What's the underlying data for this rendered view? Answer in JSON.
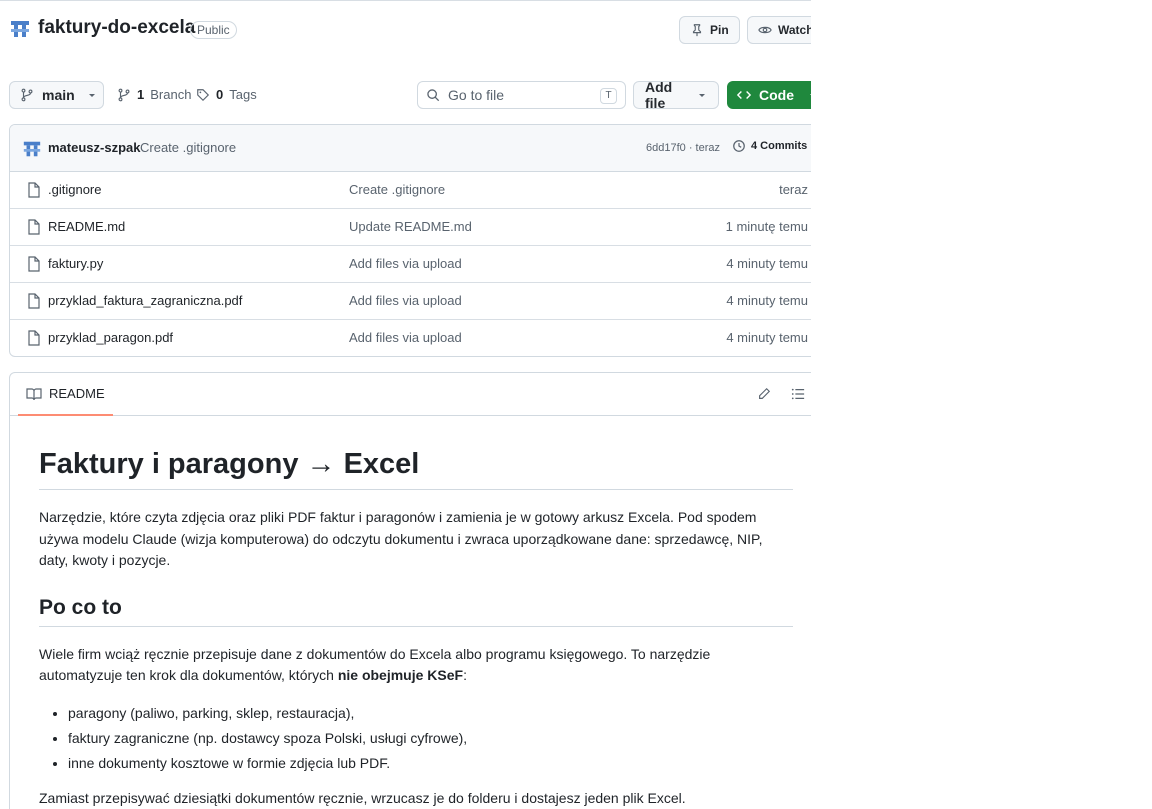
{
  "repo": {
    "name": "faktury-do-excela",
    "visibility": "Public",
    "pin_label": "Pin",
    "watch_label": "Watch"
  },
  "toolbar": {
    "branch": "main",
    "branch_count": "1",
    "branch_label": "Branch",
    "tag_count": "0",
    "tag_label": "Tags",
    "goto_placeholder": "Go to file",
    "goto_shortcut": "T",
    "add_file_label": "Add file",
    "code_label": "Code"
  },
  "latest_commit": {
    "author": "mateusz-szpak",
    "message": "Create .gitignore",
    "sha_time": "6dd17f0 · teraz",
    "commits_label": "4 Commits"
  },
  "files": [
    {
      "name": ".gitignore",
      "commit": "Create .gitignore",
      "time": "teraz"
    },
    {
      "name": "README.md",
      "commit": "Update README.md",
      "time": "1 minutę temu"
    },
    {
      "name": "faktury.py",
      "commit": "Add files via upload",
      "time": "4 minuty temu"
    },
    {
      "name": "przyklad_faktura_zagraniczna.pdf",
      "commit": "Add files via upload",
      "time": "4 minuty temu"
    },
    {
      "name": "przyklad_paragon.pdf",
      "commit": "Add files via upload",
      "time": "4 minuty temu"
    }
  ],
  "readme": {
    "tab_label": "README",
    "title": "Faktury i paragony → Excel",
    "intro": "Narzędzie, które czyta zdjęcia oraz pliki PDF faktur i paragonów i zamienia je w gotowy arkusz Excela. Pod spodem używa modelu Claude (wizja komputerowa) do odczytu dokumentu i zwraca uporządkowane dane: sprzedawcę, NIP, daty, kwoty i pozycje.",
    "section_title": "Po co to",
    "section_text_before": "Wiele firm wciąż ręcznie przepisuje dane z dokumentów do Excela albo programu księgowego. To narzędzie automatyzuje ten krok dla dokumentów, których ",
    "section_text_strong": "nie obejmuje KSeF",
    "section_text_after": ":",
    "bullets": [
      "paragony (paliwo, parking, sklep, restauracja),",
      "faktury zagraniczne (np. dostawcy spoza Polski, usługi cyfrowe),",
      "inne dokumenty kosztowe w formie zdjęcia lub PDF."
    ],
    "closing": "Zamiast przepisywać dziesiątki dokumentów ręcznie, wrzucasz je do folderu i dostajesz jeden plik Excel."
  },
  "colors": {
    "accent_green": "#1f883d",
    "tab_underline": "#fd8c73",
    "avatar_blue": "#4a7fc9"
  }
}
